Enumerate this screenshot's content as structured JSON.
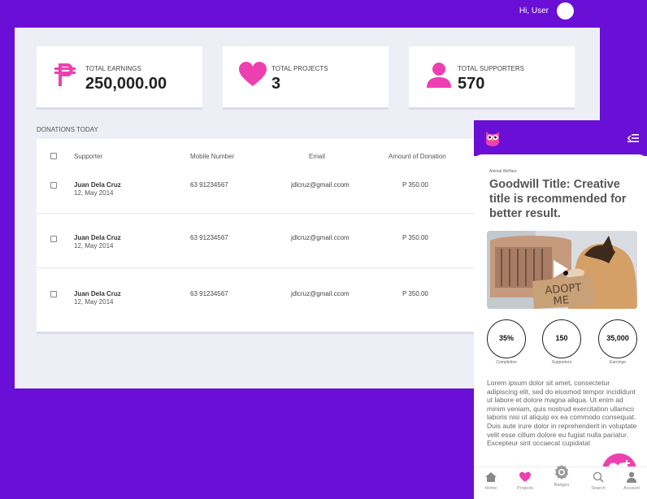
{
  "header": {
    "greeting": "Hi, User"
  },
  "stats": [
    {
      "label": "TOTAL EARNINGS",
      "value": "250,000.00",
      "icon": "peso-icon"
    },
    {
      "label": "TOTAL PROJECTS",
      "value": "3",
      "icon": "heart-icon"
    },
    {
      "label": "TOTAL SUPPORTERS",
      "value": "570",
      "icon": "person-icon"
    }
  ],
  "donations": {
    "section_title": "DONATIONS TODAY",
    "columns": [
      "Supporter",
      "Mobile Number",
      "Email",
      "Amount of Donation"
    ],
    "rows": [
      {
        "name": "Juan Dela Cruz",
        "date": "12, May 2014",
        "mobile": "63 91234567",
        "email": "jdlcruz@gmail.ccom",
        "amount": "P 350.00"
      },
      {
        "name": "Juan Dela Cruz",
        "date": "12, May 2014",
        "mobile": "63 91234567",
        "email": "jdlcruz@gmail.ccom",
        "amount": "P 350.00"
      },
      {
        "name": "Juan Dela Cruz",
        "date": "12, May 2014",
        "mobile": "63 91234567",
        "email": "jdlcruz@gmail.ccom",
        "amount": "P 350.00"
      }
    ]
  },
  "phone": {
    "category": "Animal Welfare",
    "title": "Goodwill Title: Creative title is recommended for better result.",
    "photo_sign": "ADOPT ME",
    "metrics": [
      {
        "value": "35%",
        "label": "Completion"
      },
      {
        "value": "150",
        "label": "Supporters"
      },
      {
        "value": "35,000",
        "label": "Earnings"
      }
    ],
    "description": "Lorem ipsum dolor sit amet, consectetur adipiscing elit, sed do eiusmod tempor incididunt ut labore et dolore magna aliqua. Ut enim ad minim veniam, quis nostrud exercitation ullamco laboris nisi ut aliquip ex ea commodo consequat. Duis aute irure dolor in reprehenderit in voluptate velit esse cillum dolore eu fugiat nulla pariatur. Excepteur sint occaecat cupidatat",
    "nav": [
      {
        "label": "Home",
        "icon": "home-icon"
      },
      {
        "label": "Projects",
        "icon": "heart-icon"
      },
      {
        "label": "Badges",
        "icon": "badge-icon"
      },
      {
        "label": "Search",
        "icon": "search-icon"
      },
      {
        "label": "Account",
        "icon": "account-icon"
      }
    ]
  },
  "colors": {
    "accent": "#6a0fd6",
    "pink": "#ee3fb1",
    "panel": "#eeeff6"
  }
}
